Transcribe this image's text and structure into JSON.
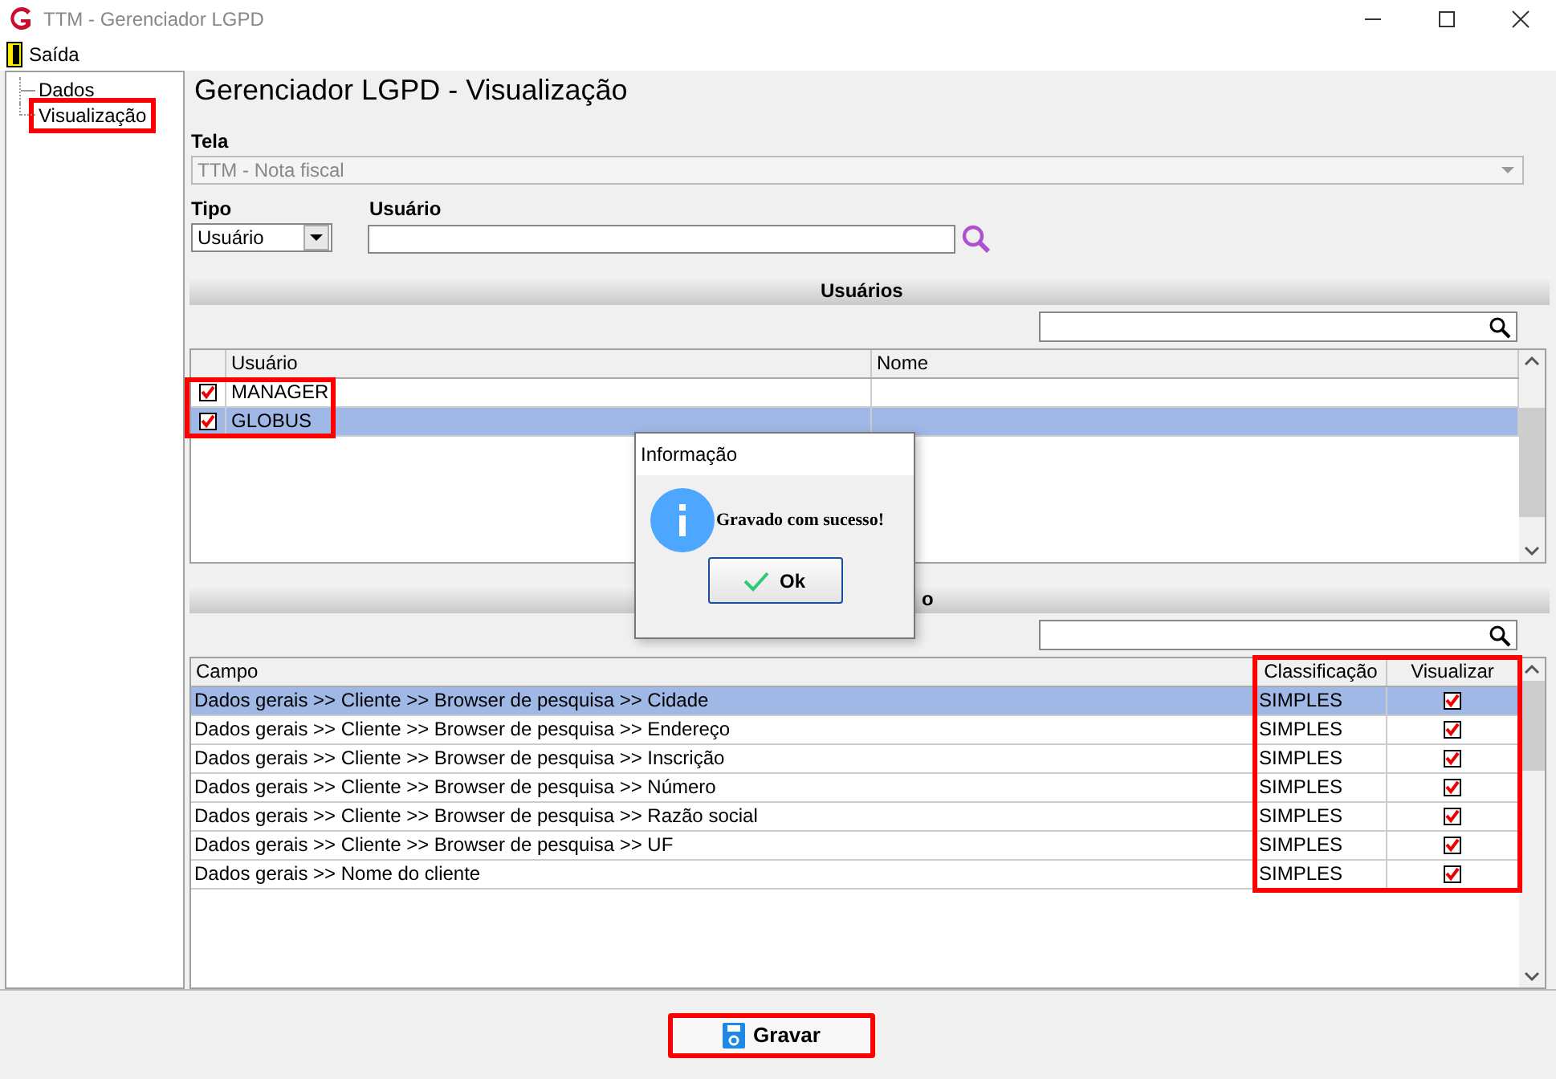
{
  "window": {
    "title": "TTM - Gerenciador LGPD"
  },
  "menu": [
    {
      "label": "Saída"
    }
  ],
  "tree": [
    {
      "label": "Dados",
      "highlighted": false
    },
    {
      "label": "Visualização",
      "highlighted": true
    }
  ],
  "heading": "Gerenciador LGPD - Visualização",
  "tela": {
    "label": "Tela",
    "value": "TTM - Nota fiscal"
  },
  "tipo": {
    "label": "Tipo",
    "value": "Usuário"
  },
  "usuario": {
    "label": "Usuário"
  },
  "users_section": {
    "title": "Usuários"
  },
  "users_grid": {
    "columns": [
      "Usuário",
      "Nome"
    ],
    "rows": [
      {
        "usuario": "MANAGER",
        "checked": true,
        "selected": false,
        "highlighted": true
      },
      {
        "usuario": "GLOBUS",
        "checked": true,
        "selected": true,
        "highlighted": true
      }
    ]
  },
  "fields_section": {
    "title": "o"
  },
  "fields_grid": {
    "columns": [
      {
        "label": "Campo",
        "highlighted": false
      },
      {
        "label": "Classificação",
        "highlighted": true
      },
      {
        "label": "Visualizar",
        "highlighted": true
      }
    ],
    "rows": [
      {
        "campo": "Dados gerais >> Cliente >> Browser de pesquisa >> Cidade",
        "classificacao": "SIMPLES",
        "visualizar": true,
        "selected": true
      },
      {
        "campo": "Dados gerais >> Cliente >> Browser de pesquisa >> Endereço",
        "classificacao": "SIMPLES",
        "visualizar": true,
        "selected": false
      },
      {
        "campo": "Dados gerais >> Cliente >> Browser de pesquisa >> Inscrição",
        "classificacao": "SIMPLES",
        "visualizar": true,
        "selected": false
      },
      {
        "campo": "Dados gerais >> Cliente >> Browser de pesquisa >> Número",
        "classificacao": "SIMPLES",
        "visualizar": true,
        "selected": false
      },
      {
        "campo": "Dados gerais >> Cliente >> Browser de pesquisa >> Razão social",
        "classificacao": "SIMPLES",
        "visualizar": true,
        "selected": false
      },
      {
        "campo": "Dados gerais >> Cliente >> Browser de pesquisa >> UF",
        "classificacao": "SIMPLES",
        "visualizar": true,
        "selected": false
      },
      {
        "campo": "Dados gerais >> Nome do cliente",
        "classificacao": "SIMPLES",
        "visualizar": true,
        "selected": false
      }
    ]
  },
  "save_button": {
    "label": "Gravar",
    "highlighted": true
  },
  "dialog": {
    "title": "Informação",
    "message": "Gravado com sucesso!",
    "button": "Ok"
  }
}
